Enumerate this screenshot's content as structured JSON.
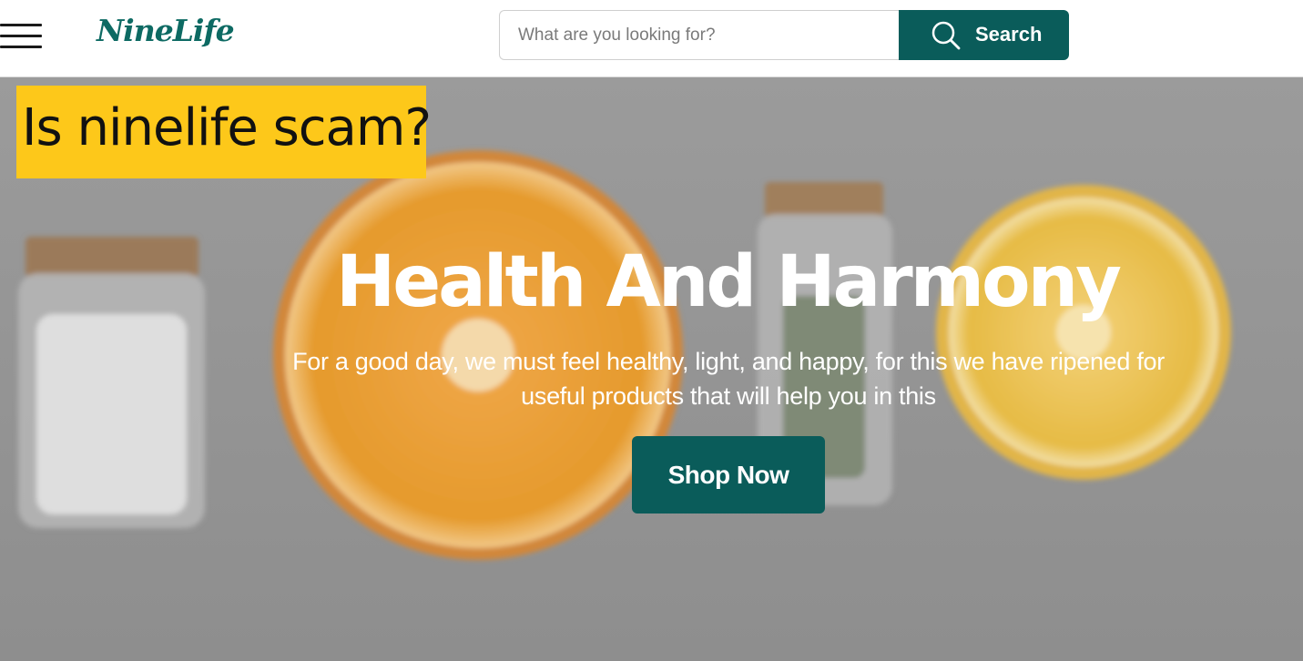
{
  "header": {
    "logo_text": "NineLife",
    "search": {
      "placeholder": "What are you looking for?",
      "value": "",
      "button_label": "Search"
    }
  },
  "overlay_tag": {
    "text": "Is ninelife scam?"
  },
  "hero": {
    "title": "Health And Harmony",
    "subtitle": "For a good day, we must feel healthy, light, and happy, for this we have ripened for useful products that will help you in this",
    "cta_label": "Shop Now"
  },
  "colors": {
    "brand": "#0a5c5a",
    "logo": "#0d6a63",
    "tag_background": "#fdc81a",
    "hero_background": "#9a9a9a"
  },
  "icons": [
    "hamburger-menu-icon",
    "search-icon"
  ]
}
